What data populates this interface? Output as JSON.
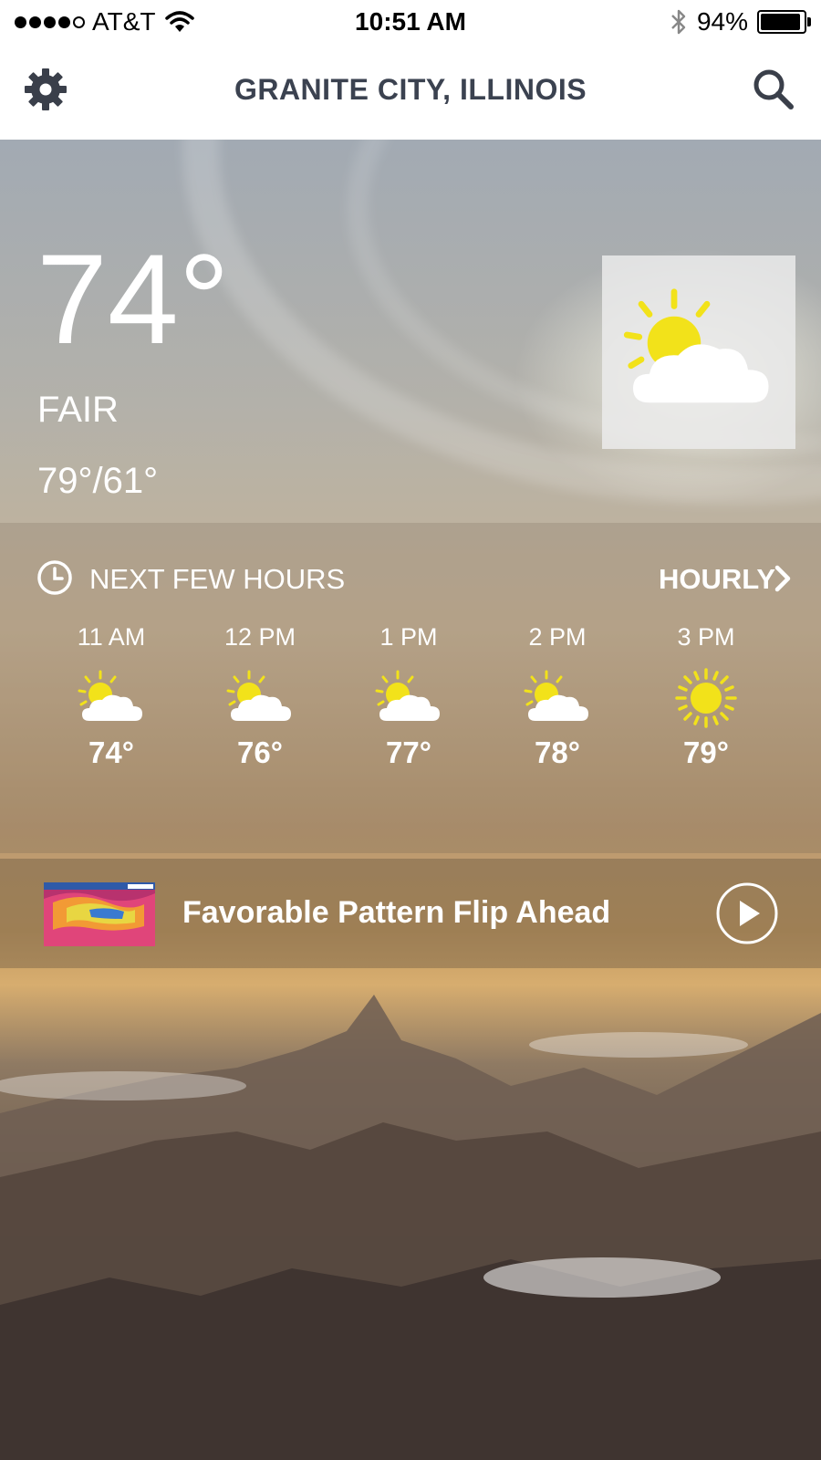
{
  "status_bar": {
    "carrier": "AT&T",
    "time": "10:51 AM",
    "battery": "94%",
    "battery_level": 0.94,
    "icons": [
      "signal-dots-icon",
      "wifi-icon",
      "bluetooth-icon",
      "battery-icon"
    ]
  },
  "header": {
    "title": "GRANITE CITY, ILLINOIS",
    "icons": [
      "gear-icon",
      "search-icon"
    ]
  },
  "current": {
    "temp": "74°",
    "condition": "FAIR",
    "hi_lo": "79°/61°",
    "icon": "partly-sunny-icon"
  },
  "hourly": {
    "title": "NEXT FEW HOURS",
    "link_label": "HOURLY",
    "hours": [
      {
        "time": "11 AM",
        "temp": "74°",
        "icon": "partly-sunny-icon"
      },
      {
        "time": "12 PM",
        "temp": "76°",
        "icon": "partly-sunny-icon"
      },
      {
        "time": "1 PM",
        "temp": "77°",
        "icon": "partly-sunny-icon"
      },
      {
        "time": "2 PM",
        "temp": "78°",
        "icon": "partly-sunny-icon"
      },
      {
        "time": "3 PM",
        "temp": "79°",
        "icon": "sunny-icon"
      }
    ]
  },
  "video": {
    "title": "Favorable Pattern Flip Ahead",
    "icon": "play-icon"
  },
  "colors": {
    "header_text": "#3b4250",
    "sun": "#f2e21a",
    "cloud": "#ffffff"
  }
}
